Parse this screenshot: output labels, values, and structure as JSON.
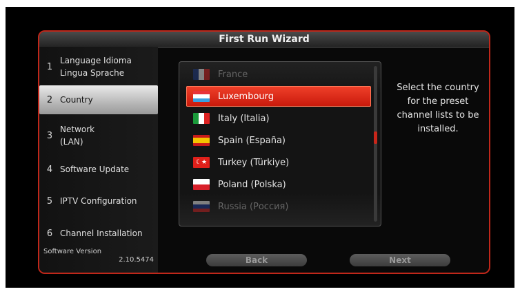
{
  "title": "First Run Wizard",
  "steps": [
    {
      "num": "1",
      "line1": "Language  Idioma",
      "line2": "Lingua  Sprache"
    },
    {
      "num": "2",
      "line1": "Country",
      "line2": ""
    },
    {
      "num": "3",
      "line1": "Network",
      "line2": "(LAN)"
    },
    {
      "num": "4",
      "line1": "Software Update",
      "line2": ""
    },
    {
      "num": "5",
      "line1": "IPTV Configuration",
      "line2": ""
    },
    {
      "num": "6",
      "line1": "Channel Installation",
      "line2": ""
    }
  ],
  "active_step": "2",
  "software_version": {
    "label": "Software Version",
    "value": "2.10.5474"
  },
  "countries": [
    {
      "name": "France",
      "flag": "france-flag-icon"
    },
    {
      "name": "Luxembourg",
      "flag": "luxembourg-flag-icon"
    },
    {
      "name": "Italy (Italia)",
      "flag": "italy-flag-icon"
    },
    {
      "name": "Spain (España)",
      "flag": "spain-flag-icon"
    },
    {
      "name": "Turkey (Türkiye)",
      "flag": "turkey-flag-icon"
    },
    {
      "name": "Poland (Polska)",
      "flag": "poland-flag-icon"
    },
    {
      "name": "Russia (Россия)",
      "flag": "russia-flag-icon"
    }
  ],
  "selected_country": "Luxembourg",
  "help_text": "Select the country for the preset channel lists to be installed.",
  "buttons": {
    "back": "Back",
    "next": "Next"
  },
  "colors": {
    "accent": "#c8190b",
    "border": "#c0271a"
  }
}
